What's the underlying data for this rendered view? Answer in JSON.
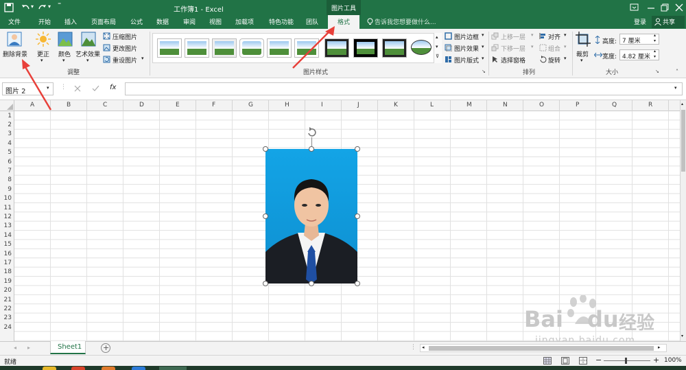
{
  "window": {
    "title": "工作簿1 - Excel",
    "context_tab_group": "图片工具"
  },
  "quick_access": {
    "save_icon": "save-icon",
    "undo_icon": "undo-icon",
    "redo_icon": "redo-icon"
  },
  "account": {
    "login": "登录",
    "share": "共享"
  },
  "tabs": [
    {
      "label": "文件"
    },
    {
      "label": "开始"
    },
    {
      "label": "插入"
    },
    {
      "label": "页面布局"
    },
    {
      "label": "公式"
    },
    {
      "label": "数据"
    },
    {
      "label": "审阅"
    },
    {
      "label": "视图"
    },
    {
      "label": "加载项"
    },
    {
      "label": "特色功能"
    },
    {
      "label": "团队"
    },
    {
      "label": "格式",
      "active": true
    }
  ],
  "tell_me": {
    "placeholder": "告诉我您想要做什么..."
  },
  "ribbon": {
    "adjust": {
      "group_label": "调整",
      "remove_bg": "删除背景",
      "corrections": "更正",
      "color": "颜色",
      "artistic": "艺术效果",
      "compress": "压缩图片",
      "change": "更改图片",
      "reset": "重设图片"
    },
    "styles": {
      "group_label": "图片样式",
      "border": "图片边框",
      "effects": "图片效果",
      "layout": "图片版式"
    },
    "arrange": {
      "group_label": "排列",
      "forward": "上移一层",
      "backward": "下移一层",
      "selection_pane": "选择窗格",
      "align": "对齐",
      "group": "组合",
      "rotate": "旋转"
    },
    "size": {
      "group_label": "大小",
      "crop": "裁剪",
      "height_label": "高度:",
      "height_value": "7 厘米",
      "width_label": "宽度:",
      "width_value": "4.82 厘米"
    }
  },
  "formula_bar": {
    "name_box": "图片 2",
    "fx": "fx",
    "formula": ""
  },
  "columns": [
    "A",
    "B",
    "C",
    "D",
    "E",
    "F",
    "G",
    "H",
    "I",
    "J",
    "K",
    "L",
    "M",
    "N",
    "O",
    "P",
    "Q",
    "R"
  ],
  "rows": [
    "1",
    "2",
    "3",
    "4",
    "5",
    "6",
    "7",
    "8",
    "9",
    "10",
    "11",
    "12",
    "13",
    "14",
    "15",
    "16",
    "17",
    "18",
    "19",
    "20",
    "21",
    "22",
    "23",
    "24"
  ],
  "sheet": {
    "tab": "Sheet1",
    "add": "+"
  },
  "status": {
    "ready": "就绪",
    "zoom": "100%"
  },
  "watermark": {
    "brand": "Bai",
    "brand2": "du",
    "cn": "经验",
    "url": "jingyan.baidu.com"
  },
  "colors": {
    "excel_green": "#217346",
    "accent_red": "#e8403a",
    "photo_bg": "#1aa0e0"
  }
}
